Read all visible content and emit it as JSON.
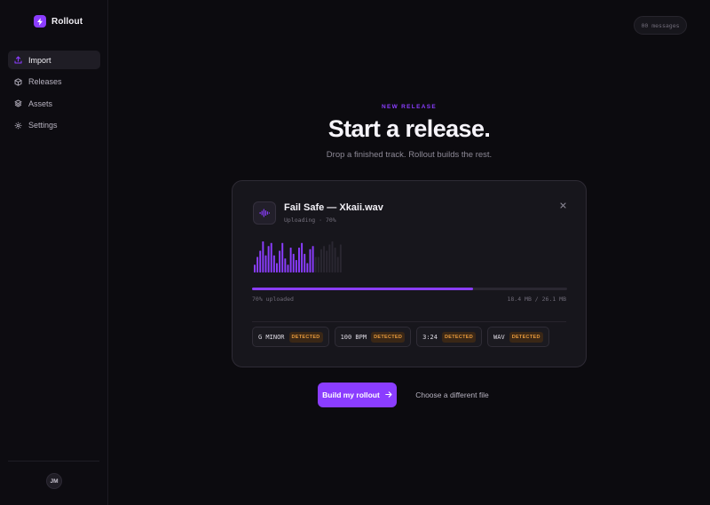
{
  "brand": {
    "name": "Rollout",
    "icon": "bolt-icon",
    "accent": "#8b3dff"
  },
  "sidebar": {
    "items": [
      {
        "label": "Import",
        "icon": "upload-icon",
        "active": true
      },
      {
        "label": "Releases",
        "icon": "box-icon",
        "active": false
      },
      {
        "label": "Assets",
        "icon": "layers-icon",
        "active": false
      },
      {
        "label": "Settings",
        "icon": "gear-icon",
        "active": false
      }
    ],
    "user_initials": "JM"
  },
  "header": {
    "messages_label": "00 messages"
  },
  "hero": {
    "eyebrow": "NEW RELEASE",
    "title": "Start a release.",
    "subtitle": "Drop a finished track. Rollout builds the rest."
  },
  "upload": {
    "file_name": "Fail Safe — Xkaii.wav",
    "status": "Uploading · 70%",
    "progress": 0.7,
    "progress_label": "70% uploaded",
    "size_label": "18.4 MB / 26.1 MB",
    "waveform": [
      0.25,
      0.5,
      0.7,
      1.0,
      0.55,
      0.85,
      0.95,
      0.55,
      0.3,
      0.7,
      0.95,
      0.45,
      0.25,
      0.8,
      0.6,
      0.4,
      0.8,
      0.95,
      0.6,
      0.3,
      0.75,
      0.85,
      0.5,
      0.5,
      0.75,
      0.85,
      0.7,
      0.9,
      1.0,
      0.8,
      0.5,
      0.9
    ],
    "chips": [
      {
        "label": "G MINOR",
        "badge": "DETECTED"
      },
      {
        "label": "100 BPM",
        "badge": "DETECTED"
      },
      {
        "label": "3:24",
        "badge": "DETECTED"
      },
      {
        "label": "WAV",
        "badge": "DETECTED"
      }
    ]
  },
  "actions": {
    "primary_label": "Build my rollout",
    "secondary_label": "Choose a different file"
  }
}
